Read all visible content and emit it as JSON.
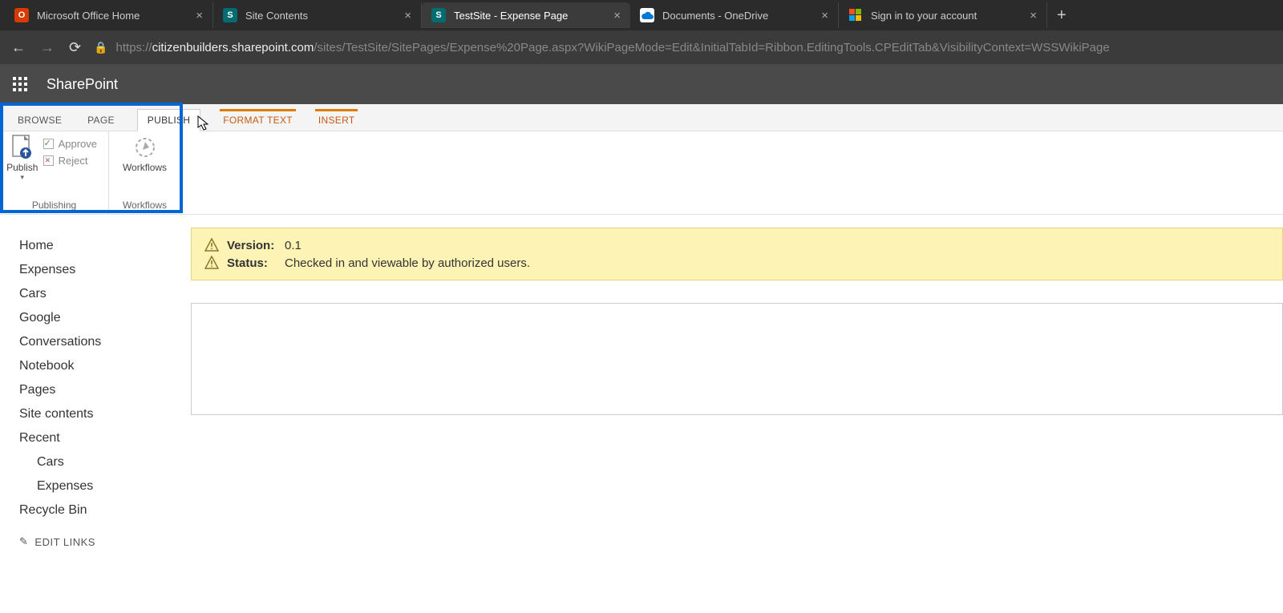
{
  "browser": {
    "tabs": [
      {
        "title": "Microsoft Office Home",
        "favicon": "office"
      },
      {
        "title": "Site Contents",
        "favicon": "sharepoint"
      },
      {
        "title": "TestSite - Expense Page",
        "favicon": "sharepoint",
        "active": true
      },
      {
        "title": "Documents - OneDrive",
        "favicon": "onedrive"
      },
      {
        "title": "Sign in to your account",
        "favicon": "microsoft"
      }
    ],
    "url_host": "citizenbuilders.sharepoint.com",
    "url_prefix": "https://",
    "url_path": "/sites/TestSite/SitePages/Expense%20Page.aspx?WikiPageMode=Edit&InitialTabId=Ribbon.EditingTools.CPEditTab&VisibilityContext=WSSWikiPage"
  },
  "suite": {
    "brand": "SharePoint"
  },
  "ribbon": {
    "tabs": {
      "browse": "BROWSE",
      "page": "PAGE",
      "publish": "PUBLISH",
      "format_text": "FORMAT TEXT",
      "insert": "INSERT"
    },
    "publish_group": {
      "publish_btn": "Publish",
      "approve": "Approve",
      "reject": "Reject",
      "group_label_publishing": "Publishing",
      "workflows_btn": "Workflows",
      "group_label_workflows": "Workflows"
    }
  },
  "leftnav": {
    "items": [
      "Home",
      "Expenses",
      "Cars",
      "Google",
      "Conversations",
      "Notebook",
      "Pages",
      "Site contents",
      "Recent"
    ],
    "recent_sub": [
      "Cars",
      "Expenses"
    ],
    "recycle": "Recycle Bin",
    "edit_links": "EDIT LINKS"
  },
  "status": {
    "version_label": "Version:",
    "version_value": "0.1",
    "status_label": "Status:",
    "status_value": "Checked in and viewable by authorized users."
  }
}
